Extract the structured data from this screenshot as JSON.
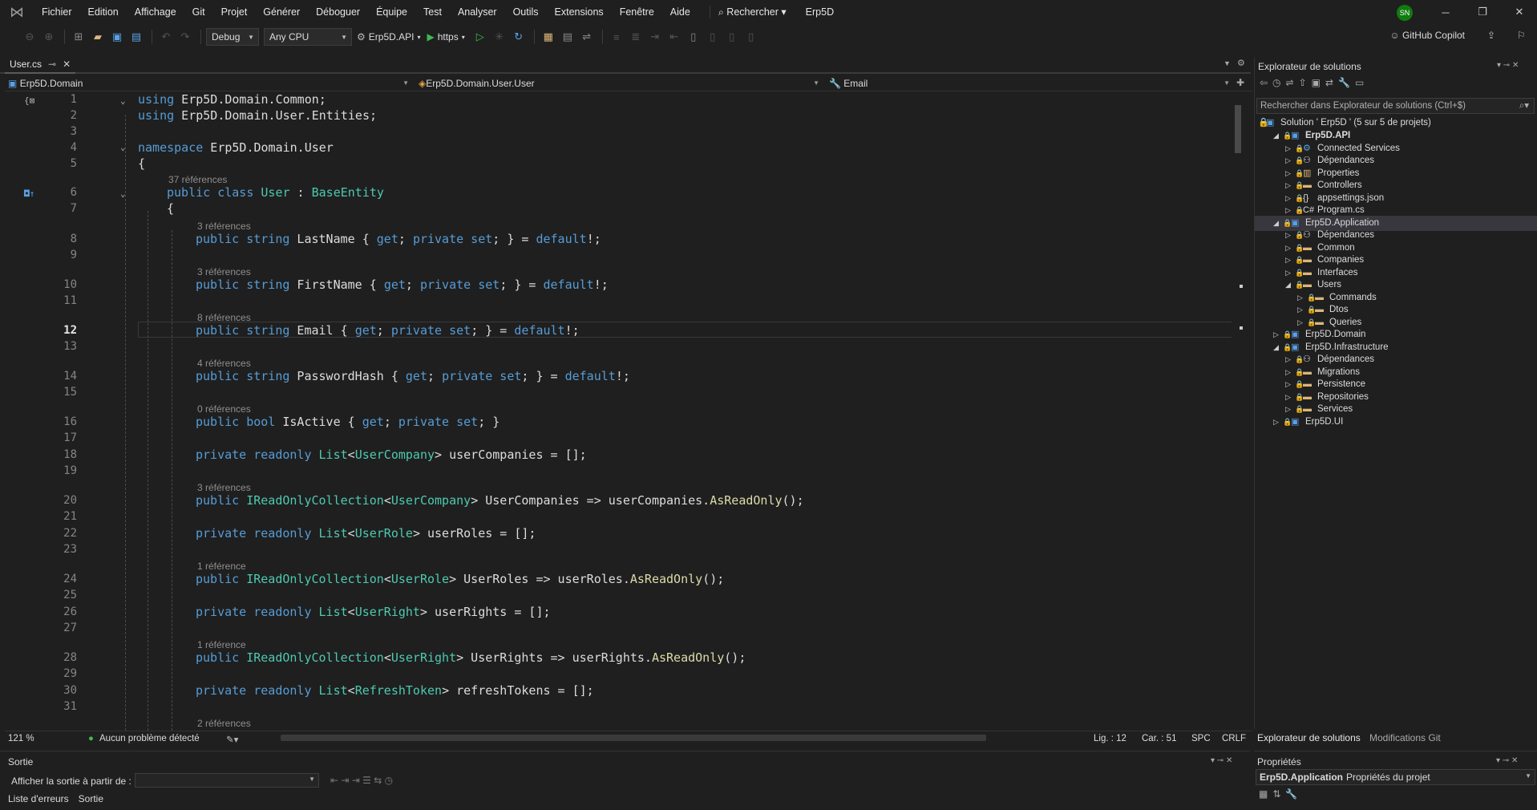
{
  "menu": {
    "items": [
      "Fichier",
      "Edition",
      "Affichage",
      "Git",
      "Projet",
      "Générer",
      "Déboguer",
      "Équipe",
      "Test",
      "Analyser",
      "Outils",
      "Extensions",
      "Fenêtre",
      "Aide"
    ],
    "search_label": "Rechercher",
    "project_name": "Erp5D",
    "avatar_initials": "SN"
  },
  "toolbar": {
    "config": "Debug",
    "platform": "Any CPU",
    "startup_project": "Erp5D.API",
    "run_profile": "https",
    "copilot_label": "GitHub Copilot"
  },
  "doc_tab": {
    "name": "User.cs",
    "pin": "⊸",
    "close": "✕"
  },
  "navbar": {
    "project": "Erp5D.Domain",
    "type": "Erp5D.Domain.User.User",
    "member": "Email"
  },
  "editor": {
    "current_line": 12,
    "line_numbers": [
      "1",
      "2",
      "3",
      "4",
      "5",
      "6",
      "7",
      "8",
      "9",
      "10",
      "11",
      "12",
      "13",
      "14",
      "15",
      "16",
      "17",
      "18",
      "19",
      "20",
      "21",
      "22",
      "23",
      "24",
      "25",
      "26",
      "27",
      "28",
      "29",
      "30",
      "31"
    ],
    "lenses": {
      "class": "37 références",
      "lastname": "3 références",
      "firstname": "3 références",
      "email": "8 références",
      "password": "4 références",
      "isactive": "0 références",
      "usercompanies": "3 références",
      "userroles": "1 référence",
      "userrights": "1 référence",
      "bottom": "2 références"
    }
  },
  "status": {
    "zoom": "121 %",
    "problems": "Aucun problème détecté",
    "line": "Lig. : 12",
    "col": "Car. : 51",
    "spc": "SPC",
    "eol": "CRLF"
  },
  "output": {
    "title": "Sortie",
    "show_from": "Afficher la sortie à partir de :",
    "tabs": [
      "Liste d'erreurs",
      "Sortie"
    ]
  },
  "solution_explorer": {
    "title": "Explorateur de solutions",
    "search_placeholder": "Rechercher dans Explorateur de solutions (Ctrl+$)",
    "solution": "Solution ' Erp5D ' (5 sur 5 de projets)",
    "tree": [
      {
        "label": "Erp5D.API",
        "depth": 1,
        "open": true,
        "kind": "project",
        "bold": true
      },
      {
        "label": "Connected Services",
        "depth": 2,
        "open": false,
        "kind": "service"
      },
      {
        "label": "Dépendances",
        "depth": 2,
        "open": false,
        "kind": "deps"
      },
      {
        "label": "Properties",
        "depth": 2,
        "open": false,
        "kind": "props"
      },
      {
        "label": "Controllers",
        "depth": 2,
        "open": false,
        "kind": "folder"
      },
      {
        "label": "appsettings.json",
        "depth": 2,
        "open": false,
        "kind": "json"
      },
      {
        "label": "Program.cs",
        "depth": 2,
        "open": false,
        "kind": "cs"
      },
      {
        "label": "Erp5D.Application",
        "depth": 1,
        "open": true,
        "kind": "project",
        "selected": true
      },
      {
        "label": "Dépendances",
        "depth": 2,
        "open": false,
        "kind": "deps"
      },
      {
        "label": "Common",
        "depth": 2,
        "open": false,
        "kind": "folder"
      },
      {
        "label": "Companies",
        "depth": 2,
        "open": false,
        "kind": "folder"
      },
      {
        "label": "Interfaces",
        "depth": 2,
        "open": false,
        "kind": "folder"
      },
      {
        "label": "Users",
        "depth": 2,
        "open": true,
        "kind": "folder"
      },
      {
        "label": "Commands",
        "depth": 3,
        "open": false,
        "kind": "folder"
      },
      {
        "label": "Dtos",
        "depth": 3,
        "open": false,
        "kind": "folder"
      },
      {
        "label": "Queries",
        "depth": 3,
        "open": false,
        "kind": "folder"
      },
      {
        "label": "Erp5D.Domain",
        "depth": 1,
        "open": false,
        "kind": "project"
      },
      {
        "label": "Erp5D.Infrastructure",
        "depth": 1,
        "open": true,
        "kind": "project"
      },
      {
        "label": "Dépendances",
        "depth": 2,
        "open": false,
        "kind": "deps"
      },
      {
        "label": "Migrations",
        "depth": 2,
        "open": false,
        "kind": "folder"
      },
      {
        "label": "Persistence",
        "depth": 2,
        "open": false,
        "kind": "folder"
      },
      {
        "label": "Repositories",
        "depth": 2,
        "open": false,
        "kind": "folder"
      },
      {
        "label": "Services",
        "depth": 2,
        "open": false,
        "kind": "folder"
      },
      {
        "label": "Erp5D.UI",
        "depth": 1,
        "open": false,
        "kind": "project"
      }
    ],
    "tabs": [
      "Explorateur de solutions",
      "Modifications Git"
    ]
  },
  "properties": {
    "title": "Propriétés",
    "object": "Erp5D.Application",
    "object_type": "Propriétés du projet"
  }
}
